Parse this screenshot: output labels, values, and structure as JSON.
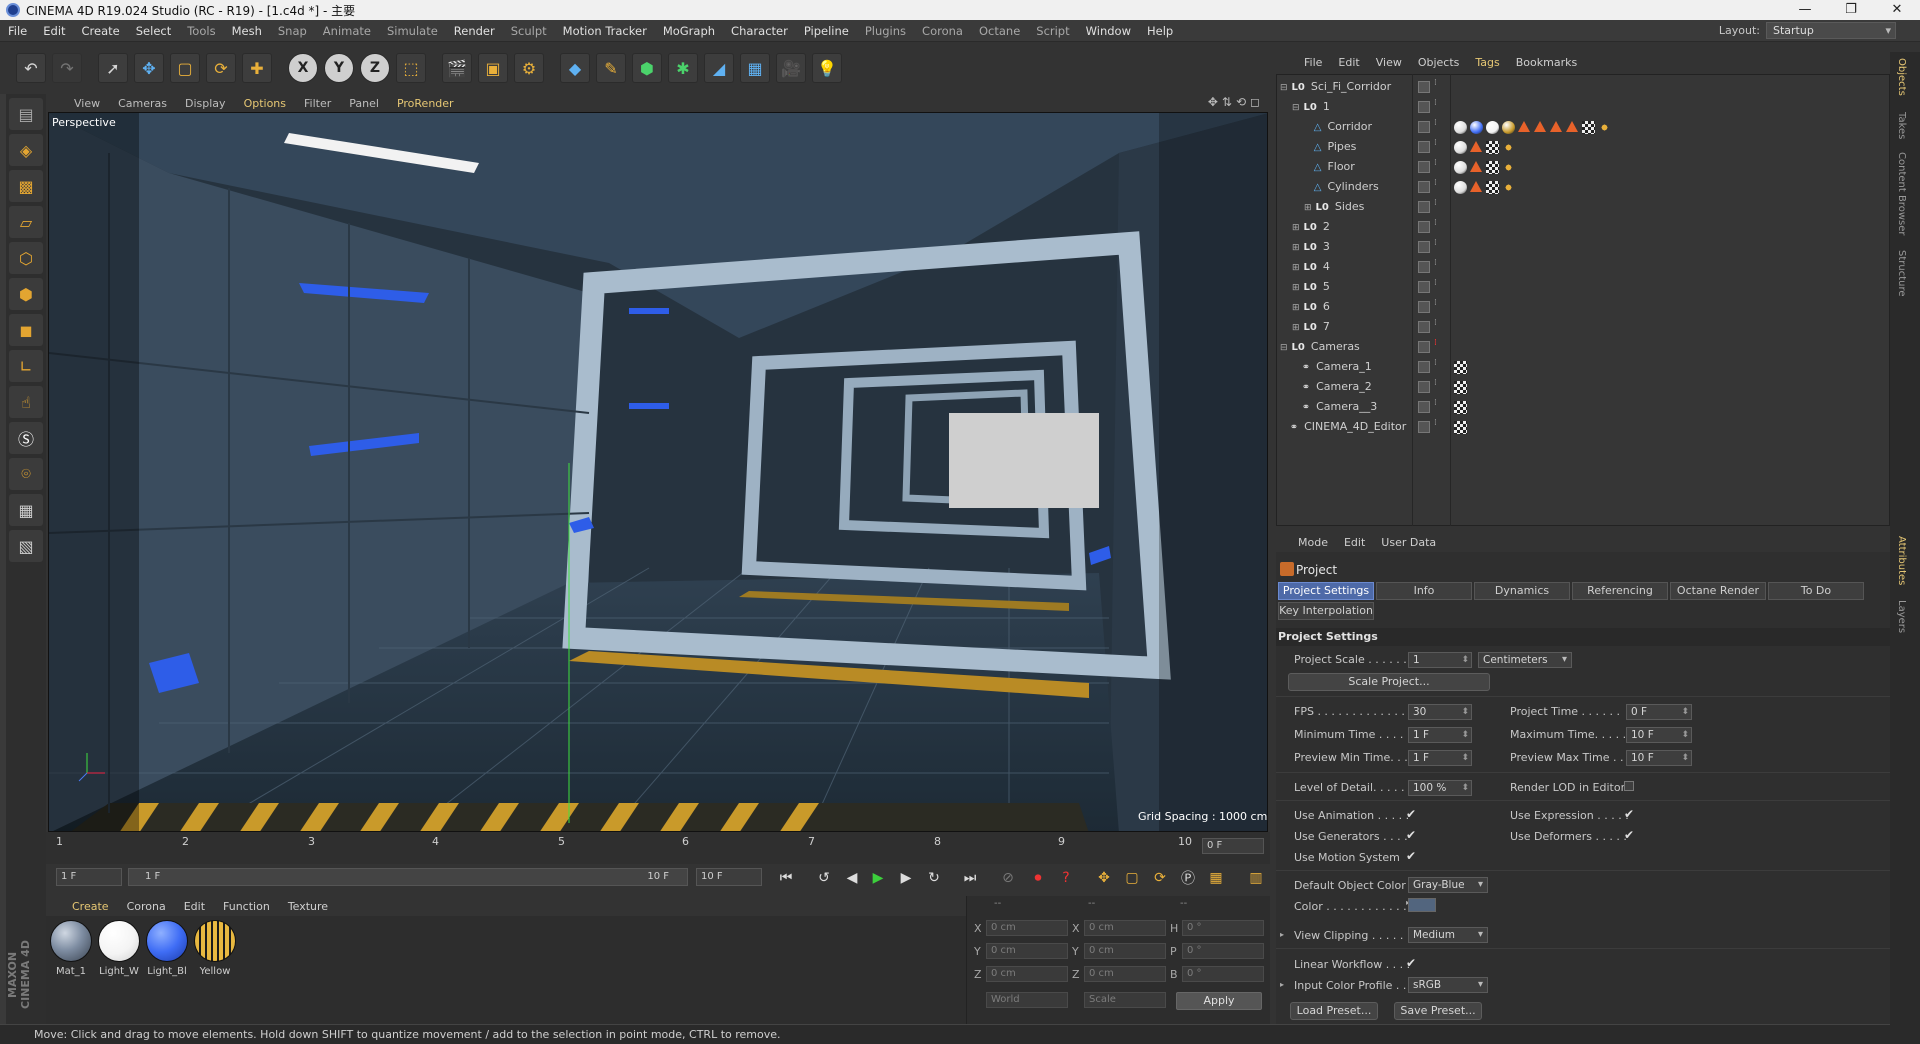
{
  "window": {
    "title": "CINEMA 4D R19.024 Studio (RC - R19) - [1.c4d *] - 主要"
  },
  "menubar": {
    "items": [
      "File",
      "Edit",
      "Create",
      "Select",
      "Tools",
      "Mesh",
      "Snap",
      "Animate",
      "Simulate",
      "Render",
      "Sculpt",
      "Motion Tracker",
      "MoGraph",
      "Character",
      "Pipeline",
      "Plugins",
      "Corona",
      "Octane",
      "Script",
      "Window",
      "Help"
    ],
    "layout_label": "Layout:",
    "layout_value": "Startup"
  },
  "viewport": {
    "menu": [
      "View",
      "Cameras",
      "Display",
      "Options",
      "Filter",
      "Panel",
      "ProRender"
    ],
    "label": "Perspective",
    "grid_spacing": "Grid Spacing : 1000 cm"
  },
  "timeline": {
    "ticks": [
      "1",
      "2",
      "3",
      "4",
      "5",
      "6",
      "7",
      "8",
      "9",
      "10"
    ],
    "current_frame": "0 F",
    "start_field": "1 F",
    "range_start": "1 F",
    "range_end": "10 F",
    "end_field": "10 F"
  },
  "materials": {
    "menu": [
      "Create",
      "Corona",
      "Edit",
      "Function",
      "Texture"
    ],
    "items": [
      {
        "label": "Mat_1",
        "color": "#7f8ea3"
      },
      {
        "label": "Light_W",
        "color": "#f4f4f4"
      },
      {
        "label": "Light_Bl",
        "color": "#3f6df5"
      },
      {
        "label": "Yellow",
        "color": "#c89a2a"
      }
    ]
  },
  "coords": {
    "headers": [
      "--",
      "--",
      "--"
    ],
    "rows": [
      {
        "a": "X",
        "av": "0 cm",
        "b": "X",
        "bv": "0 cm",
        "c": "H",
        "cv": "0 °"
      },
      {
        "a": "Y",
        "av": "0 cm",
        "b": "Y",
        "bv": "0 cm",
        "c": "P",
        "cv": "0 °"
      },
      {
        "a": "Z",
        "av": "0 cm",
        "b": "Z",
        "bv": "0 cm",
        "c": "B",
        "cv": "0 °"
      }
    ],
    "world": "World",
    "scale": "Scale",
    "apply": "Apply"
  },
  "status": "Move: Click and drag to move elements. Hold down SHIFT to quantize movement / add to the selection in point mode, CTRL to remove.",
  "objects": {
    "menu": [
      "File",
      "Edit",
      "View",
      "Objects",
      "Tags",
      "Bookmarks"
    ],
    "tree": [
      {
        "name": "Sci_Fi_Corridor",
        "indent": 0,
        "type": "null",
        "exp": "⊟"
      },
      {
        "name": "1",
        "indent": 1,
        "type": "null",
        "exp": "⊟"
      },
      {
        "name": "Corridor",
        "indent": 2,
        "type": "obj",
        "exp": ""
      },
      {
        "name": "Pipes",
        "indent": 2,
        "type": "obj",
        "exp": ""
      },
      {
        "name": "Floor",
        "indent": 2,
        "type": "obj",
        "exp": ""
      },
      {
        "name": "Cylinders",
        "indent": 2,
        "type": "obj",
        "exp": ""
      },
      {
        "name": "Sides",
        "indent": 2,
        "type": "null",
        "exp": "⊞"
      },
      {
        "name": "2",
        "indent": 1,
        "type": "null",
        "exp": "⊞"
      },
      {
        "name": "3",
        "indent": 1,
        "type": "null",
        "exp": "⊞"
      },
      {
        "name": "4",
        "indent": 1,
        "type": "null",
        "exp": "⊞"
      },
      {
        "name": "5",
        "indent": 1,
        "type": "null",
        "exp": "⊞"
      },
      {
        "name": "6",
        "indent": 1,
        "type": "null",
        "exp": "⊞"
      },
      {
        "name": "7",
        "indent": 1,
        "type": "null",
        "exp": "⊞"
      },
      {
        "name": "Cameras",
        "indent": 0,
        "type": "null",
        "exp": "⊟"
      },
      {
        "name": "Camera_1",
        "indent": 1,
        "type": "cam",
        "exp": ""
      },
      {
        "name": "Camera_2",
        "indent": 1,
        "type": "cam",
        "exp": ""
      },
      {
        "name": "Camera__3",
        "indent": 1,
        "type": "cam",
        "exp": ""
      },
      {
        "name": "CINEMA_4D_Editor",
        "indent": 0,
        "type": "cam",
        "exp": ""
      }
    ]
  },
  "side_tabs": [
    "Objects",
    "Takes",
    "Content Browser",
    "Structure",
    "Attributes",
    "Layers"
  ],
  "attributes": {
    "menu": [
      "Mode",
      "Edit",
      "User Data"
    ],
    "title": "Project",
    "tabs": [
      "Project Settings",
      "Info",
      "Dynamics",
      "Referencing",
      "Octane Render",
      "To Do"
    ],
    "tab2": "Key Interpolation",
    "section": "Project Settings",
    "project_scale_label": "Project Scale . . . . . .",
    "project_scale": "1",
    "project_scale_unit": "Centimeters",
    "scale_project_btn": "Scale Project...",
    "fps_label": "FPS . . . . . . . . . . . . . .",
    "fps": "30",
    "project_time_label": "Project Time . . . . . .",
    "project_time": "0 F",
    "min_time_label": "Minimum Time . . . . .",
    "min_time": "1 F",
    "max_time_label": "Maximum Time. . . . .",
    "max_time": "10 F",
    "prev_min_label": "Preview Min Time. . .",
    "prev_min": "1 F",
    "prev_max_label": "Preview Max Time . . .",
    "prev_max": "10 F",
    "lod_label": "Level of Detail. . . . . .",
    "lod": "100 %",
    "render_lod_label": "Render LOD in Editor",
    "use_anim_label": "Use Animation . . . . .",
    "use_expr_label": "Use Expression . . . . .",
    "use_gen_label": "Use Generators . . . .",
    "use_def_label": "Use Deformers . . . . .",
    "use_motion_label": "Use Motion System",
    "default_color_label": "Default Object Color",
    "default_color": "Gray-Blue",
    "color_label": "Color . . . . . . . . . . . .",
    "color_swatch": "#52657e",
    "view_clip_label": "View Clipping . . . . . .",
    "view_clip": "Medium",
    "linear_label": "Linear Workflow . . . .",
    "input_profile_label": "Input Color Profile . .",
    "input_profile": "sRGB",
    "load_preset": "Load Preset...",
    "save_preset": "Save Preset..."
  }
}
